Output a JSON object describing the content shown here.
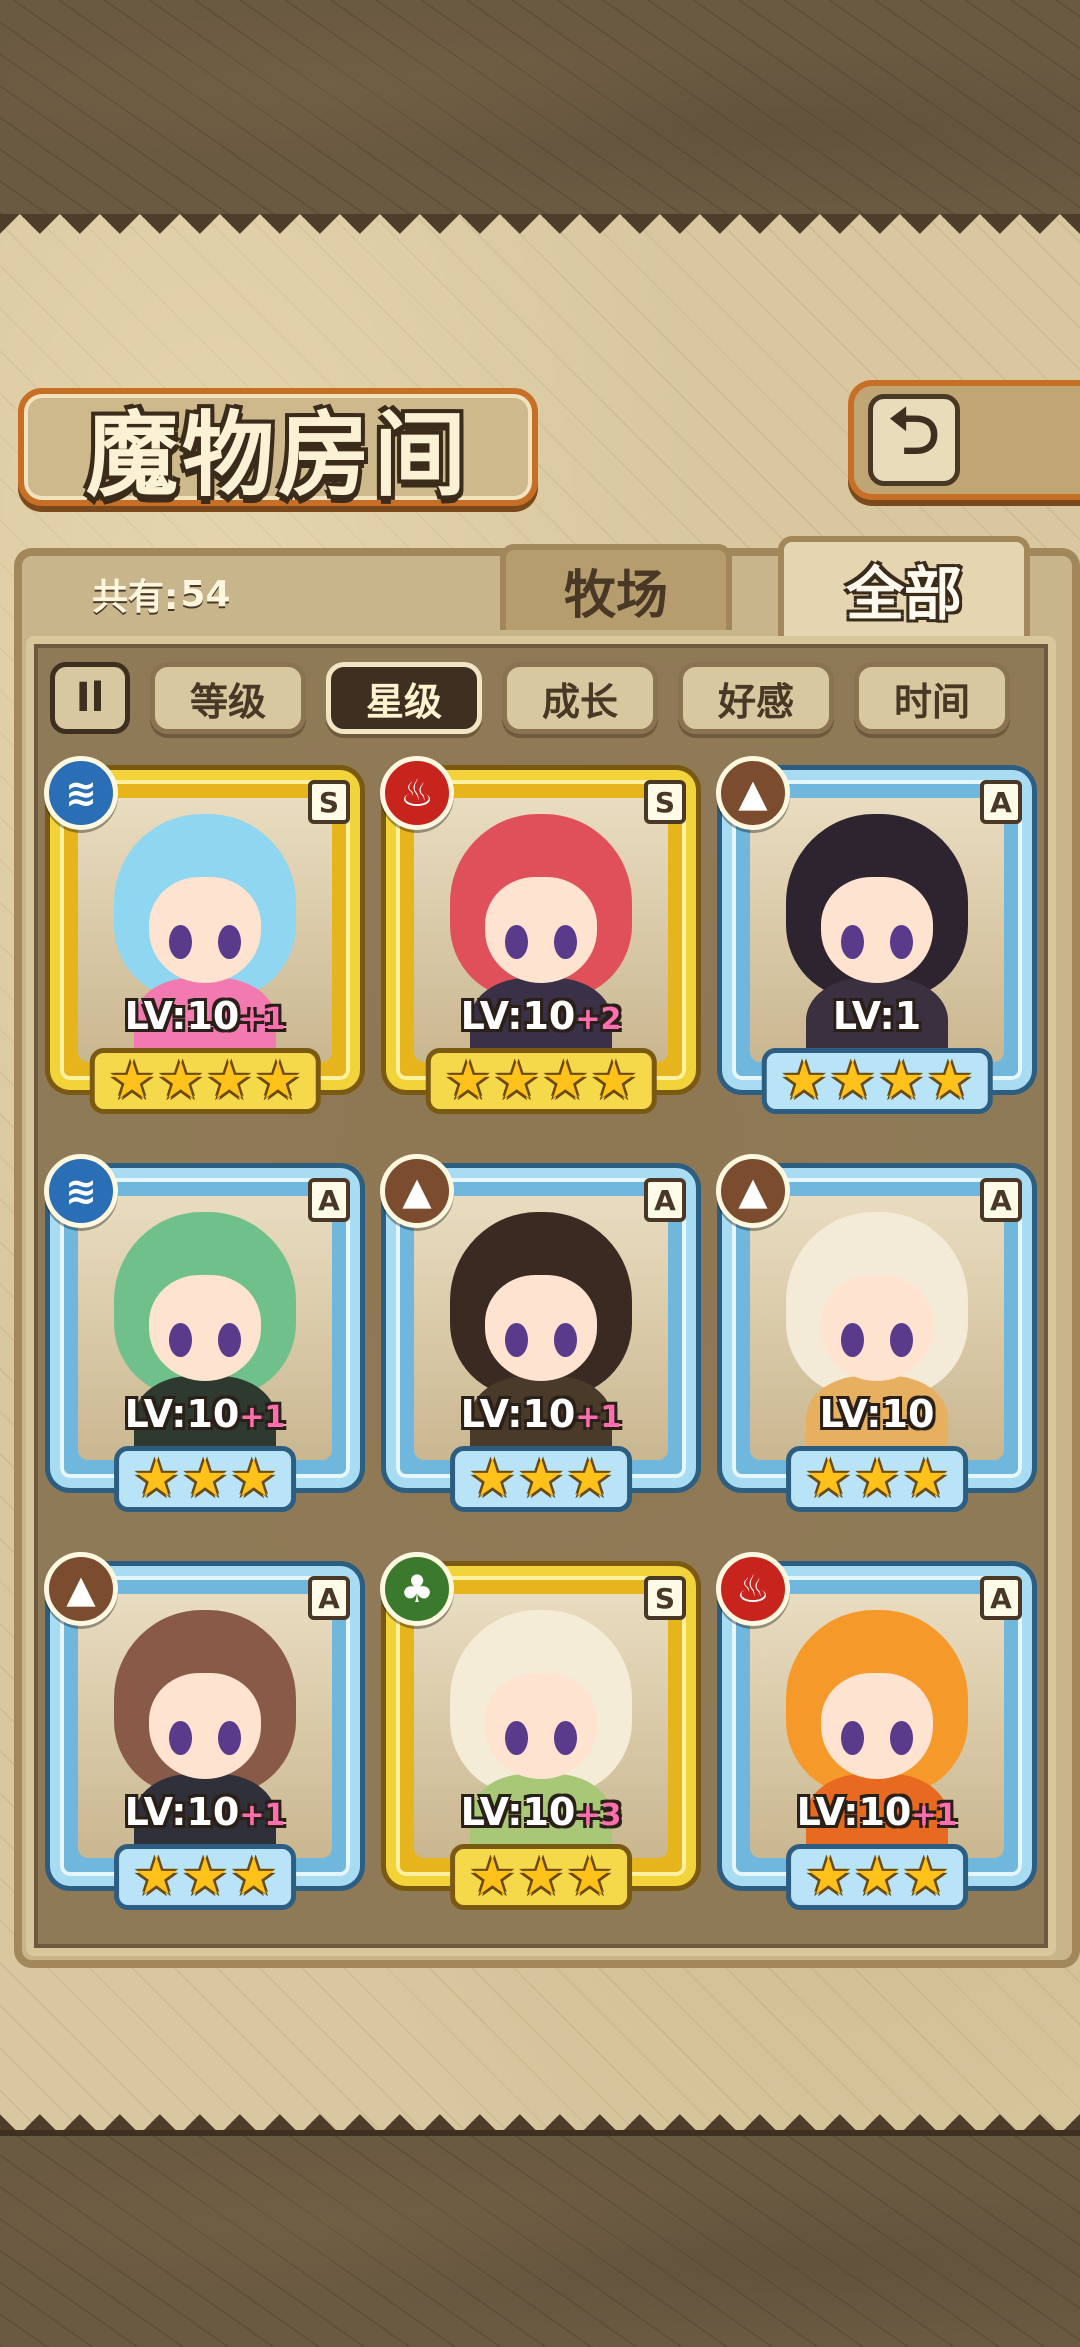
{
  "header": {
    "title": "魔物房间",
    "back_icon": "return-arrow-icon"
  },
  "collection": {
    "count_label": "共有:",
    "count_value": "54"
  },
  "tabs": [
    {
      "label": "牧场",
      "active": false
    },
    {
      "label": "全部",
      "active": true
    }
  ],
  "sort": {
    "toggle_label": "Il",
    "options": [
      {
        "label": "等级",
        "active": false
      },
      {
        "label": "星级",
        "active": true
      },
      {
        "label": "成长",
        "active": false
      },
      {
        "label": "好感",
        "active": false
      },
      {
        "label": "时间",
        "active": false
      }
    ]
  },
  "monsters": [
    {
      "element": "water",
      "rank": "S",
      "level_prefix": "LV:",
      "level": "10",
      "bonus": "+1",
      "stars": 4,
      "frame": "gold",
      "hair": "#8fd6f0",
      "body": "#f37ab0"
    },
    {
      "element": "fire",
      "rank": "S",
      "level_prefix": "LV:",
      "level": "10",
      "bonus": "+2",
      "stars": 4,
      "frame": "gold",
      "hair": "#e0505a",
      "body": "#3a3048"
    },
    {
      "element": "earth",
      "rank": "A",
      "level_prefix": "LV:",
      "level": "1",
      "bonus": "",
      "stars": 4,
      "frame": "blue",
      "hair": "#2e2430",
      "body": "#3a3040"
    },
    {
      "element": "water",
      "rank": "A",
      "level_prefix": "LV:",
      "level": "10",
      "bonus": "+1",
      "stars": 3,
      "frame": "blue",
      "hair": "#6fc08a",
      "body": "#2e3a30"
    },
    {
      "element": "earth",
      "rank": "A",
      "level_prefix": "LV:",
      "level": "10",
      "bonus": "+1",
      "stars": 3,
      "frame": "blue",
      "hair": "#3a2a22",
      "body": "#4a3a2a"
    },
    {
      "element": "earth",
      "rank": "A",
      "level_prefix": "LV:",
      "level": "10",
      "bonus": "",
      "stars": 3,
      "frame": "blue",
      "hair": "#f4ead8",
      "body": "#e6b060"
    },
    {
      "element": "earth",
      "rank": "A",
      "level_prefix": "LV:",
      "level": "10",
      "bonus": "+1",
      "stars": 3,
      "frame": "blue",
      "hair": "#8a5a48",
      "body": "#30303a"
    },
    {
      "element": "wood",
      "rank": "S",
      "level_prefix": "LV:",
      "level": "10",
      "bonus": "+3",
      "stars": 3,
      "frame": "gold",
      "hair": "#f4ecd6",
      "body": "#a8c878"
    },
    {
      "element": "fire",
      "rank": "A",
      "level_prefix": "LV:",
      "level": "10",
      "bonus": "+1",
      "stars": 3,
      "frame": "blue",
      "hair": "#f59a2a",
      "body": "#e86a20"
    }
  ],
  "element_glyphs": {
    "water": "≋",
    "fire": "♨",
    "earth": "▲",
    "wood": "♣"
  },
  "colors": {
    "panel": "#d8c79f",
    "accent": "#c76f27",
    "gold_frame": "#f3d33a",
    "blue_frame": "#a8dcf2",
    "bonus": "#ff6fb0"
  }
}
